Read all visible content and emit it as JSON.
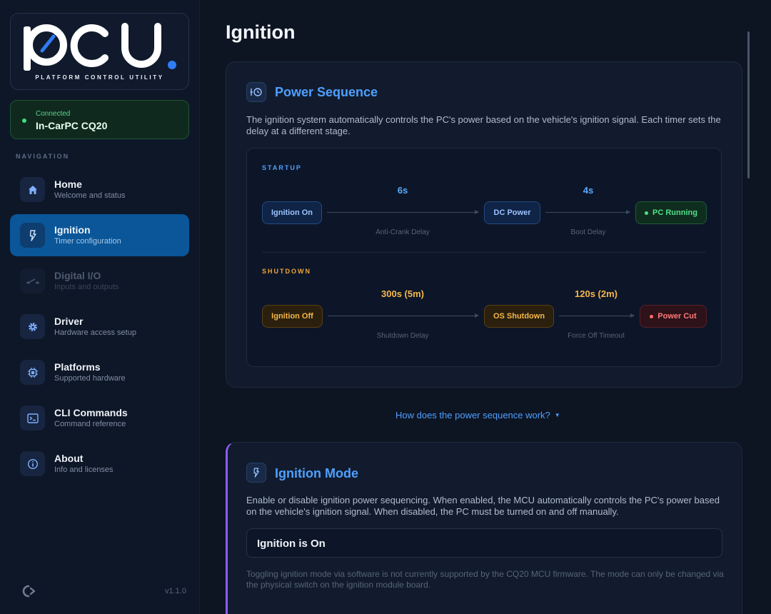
{
  "sidebar": {
    "logo_text": "PCU",
    "logo_sub": "PLATFORM CONTROL UTILITY",
    "connection": {
      "label": "Connected",
      "device": "In-CarPC CQ20"
    },
    "nav_header": "NAVIGATION",
    "items": [
      {
        "title": "Home",
        "subtitle": "Welcome and status",
        "icon": "home-icon"
      },
      {
        "title": "Ignition",
        "subtitle": "Timer configuration",
        "icon": "bolt-icon",
        "active": true
      },
      {
        "title": "Digital I/O",
        "subtitle": "Inputs and outputs",
        "icon": "switch-icon",
        "disabled": true
      },
      {
        "title": "Driver",
        "subtitle": "Hardware access setup",
        "icon": "gear-icon"
      },
      {
        "title": "Platforms",
        "subtitle": "Supported hardware",
        "icon": "chip-icon"
      },
      {
        "title": "CLI Commands",
        "subtitle": "Command reference",
        "icon": "terminal-icon"
      },
      {
        "title": "About",
        "subtitle": "Info and licenses",
        "icon": "info-icon"
      }
    ],
    "version": "v1.1.0"
  },
  "main": {
    "title": "Ignition",
    "power_sequence": {
      "title": "Power Sequence",
      "description": "The ignition system automatically controls the PC's power based on the vehicle's ignition signal. Each timer sets the delay at a different stage.",
      "startup": {
        "label": "STARTUP",
        "nodes": [
          "Ignition On",
          "DC Power",
          "PC Running"
        ],
        "times": [
          "6s",
          "4s"
        ],
        "captions": [
          "Anti-Crank Delay",
          "Boot Delay"
        ]
      },
      "shutdown": {
        "label": "SHUTDOWN",
        "nodes": [
          "Ignition Off",
          "OS Shutdown",
          "Power Cut"
        ],
        "times": [
          "300s (5m)",
          "120s (2m)"
        ],
        "captions": [
          "Shutdown Delay",
          "Force Off Timeout"
        ]
      }
    },
    "how_link": "How does the power sequence work?",
    "ignition_mode": {
      "title": "Ignition Mode",
      "description": "Enable or disable ignition power sequencing. When enabled, the MCU automatically controls the PC's power based on the vehicle's ignition signal. When disabled, the PC must be turned on and off manually.",
      "status": "Ignition is On",
      "note": "Toggling ignition mode via software is not currently supported by the CQ20 MCU firmware. The mode can only be changed via the physical switch on the ignition module board."
    }
  },
  "colors": {
    "accent_blue": "#4ea0ff",
    "active_nav": "#0a5699",
    "connected_green": "#3ee07d",
    "shutdown_amber": "#f0a53a",
    "power_cut_red": "#ff7a7a",
    "mode_accent": "#8b5cf6"
  }
}
